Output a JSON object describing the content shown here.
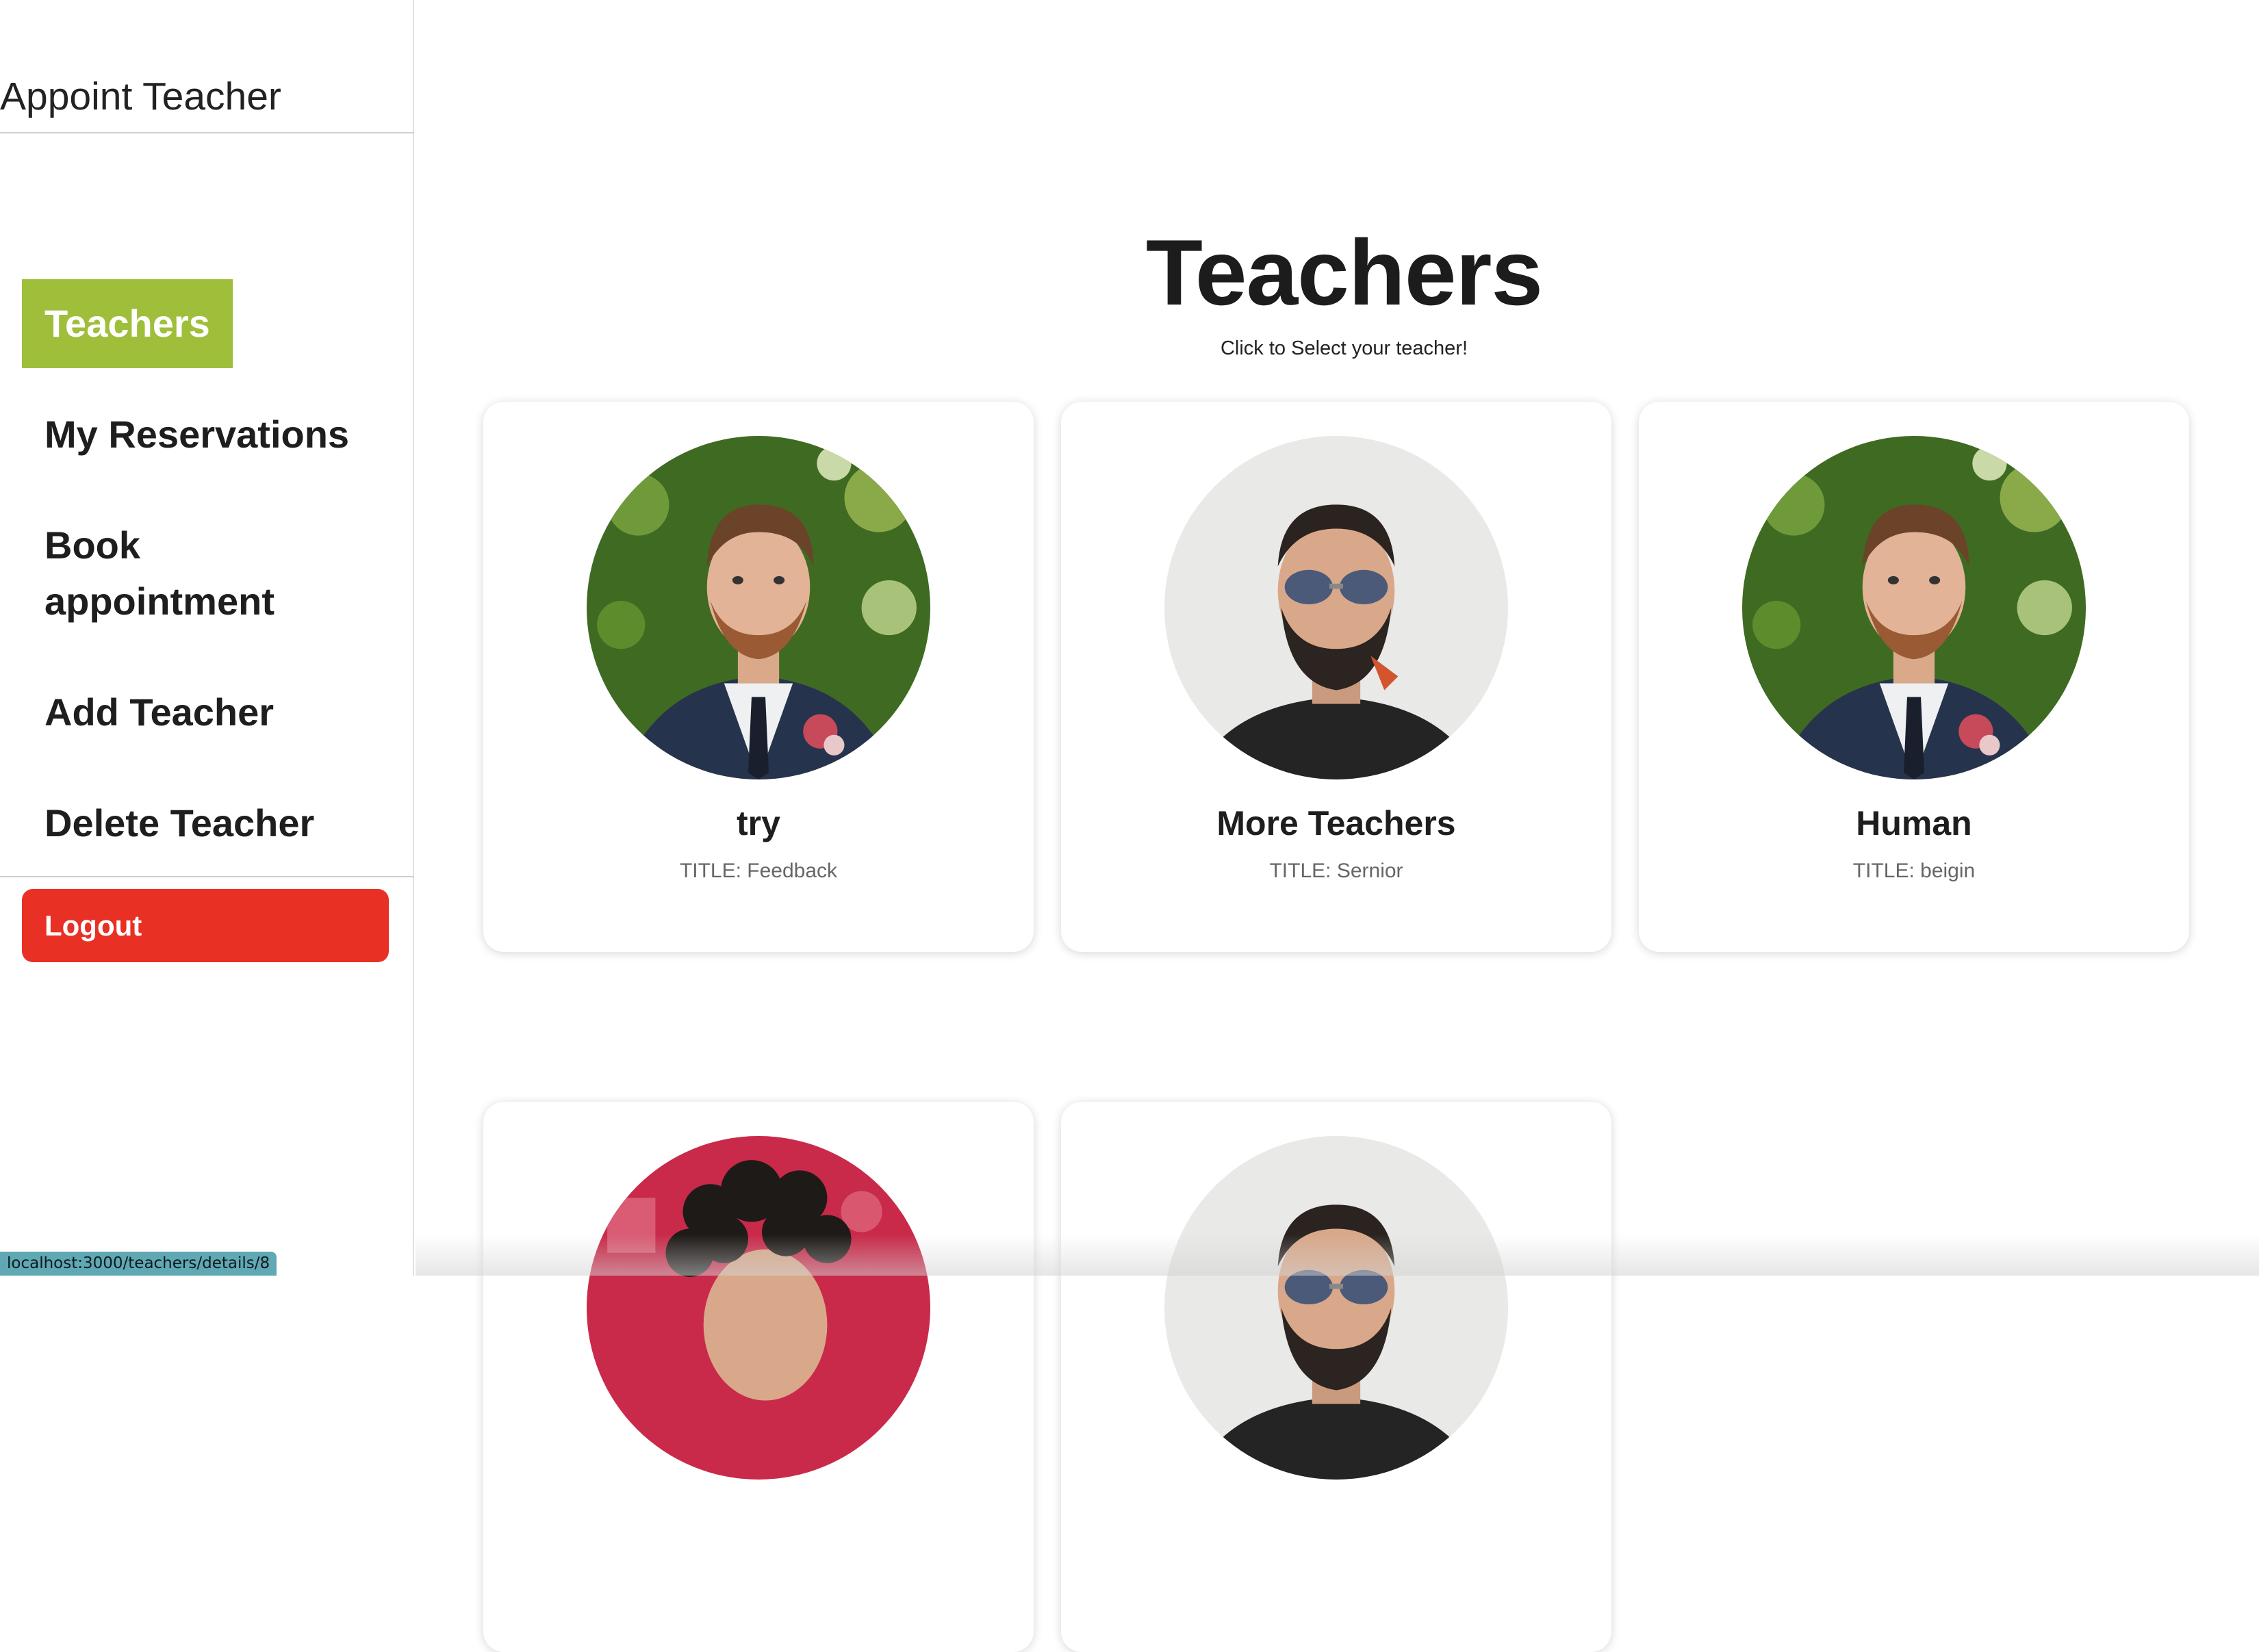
{
  "sidebar": {
    "brand": "Appoint Teacher",
    "items": [
      {
        "label": "Teachers"
      },
      {
        "label": "My Reservations"
      },
      {
        "label": "Book appointment"
      },
      {
        "label": "Add Teacher"
      },
      {
        "label": "Delete Teacher"
      }
    ],
    "logout_label": "Logout"
  },
  "main": {
    "title": "Teachers",
    "subtitle": "Click to Select your teacher!"
  },
  "teachers": [
    {
      "name": "try",
      "title": "TITLE: Feedback",
      "photo": "bearded-man-suit-garden-photo"
    },
    {
      "name": "More Teachers",
      "title": "TITLE: Sernior",
      "photo": "bearded-man-sunglasses-photo"
    },
    {
      "name": "Human",
      "title": "TITLE: beigin",
      "photo": "bearded-man-suit-garden-photo"
    },
    {
      "photo": "curly-hair-person-red-background-photo"
    },
    {
      "photo": "bearded-man-sunglasses-photo"
    }
  ],
  "status_bar": {
    "url": "localhost:3000/teachers/details/8"
  },
  "colors": {
    "active_nav": "#9fbf3b",
    "logout": "#e93024",
    "status_bar": "#5fa8b4"
  }
}
